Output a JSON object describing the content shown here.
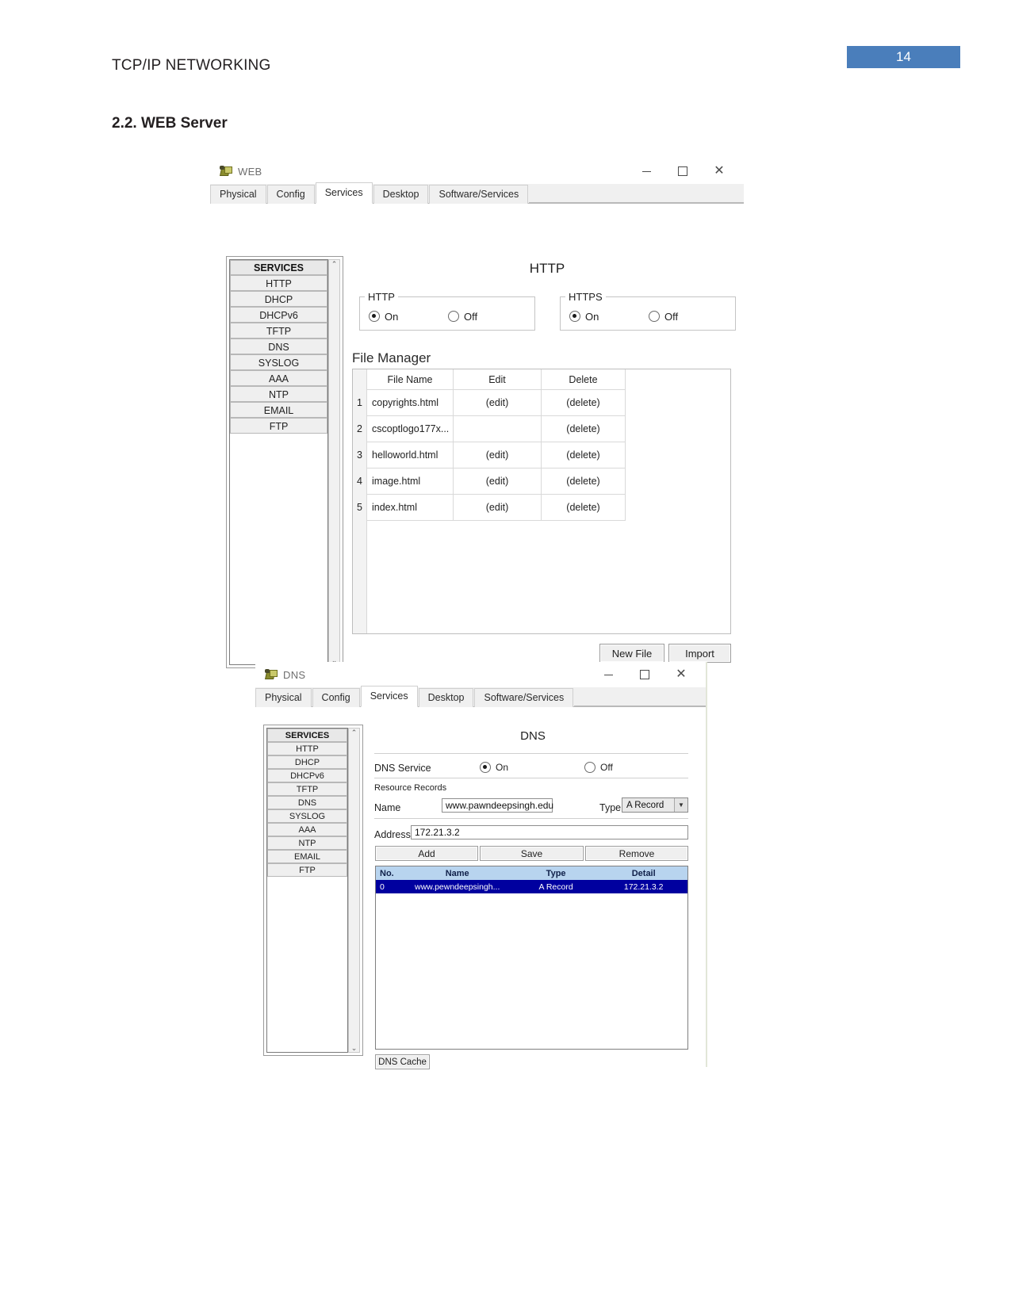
{
  "document": {
    "running_header": "TCP/IP NETWORKING",
    "page_number": "14",
    "section_heading": "2.2. WEB Server",
    "accent_color": "#4a7ebb"
  },
  "web_window": {
    "title": "WEB",
    "window_controls": {
      "minimize": "–",
      "maximize": "□",
      "close": "✕"
    },
    "tabs": [
      {
        "label": "Physical",
        "active": false
      },
      {
        "label": "Config",
        "active": false
      },
      {
        "label": "Services",
        "active": true
      },
      {
        "label": "Desktop",
        "active": false
      },
      {
        "label": "Software/Services",
        "active": false
      }
    ],
    "services_sidebar": {
      "header": "SERVICES",
      "items": [
        "HTTP",
        "DHCP",
        "DHCPv6",
        "TFTP",
        "DNS",
        "SYSLOG",
        "AAA",
        "NTP",
        "EMAIL",
        "FTP"
      ],
      "scroll_up": "⌃",
      "scroll_down": "⌄"
    },
    "panel_title": "HTTP",
    "http_group": {
      "legend": "HTTP",
      "on_label": "On",
      "off_label": "Off",
      "selected": "On"
    },
    "https_group": {
      "legend": "HTTPS",
      "on_label": "On",
      "off_label": "Off",
      "selected": "On"
    },
    "file_manager": {
      "title": "File Manager",
      "columns": [
        "File Name",
        "Edit",
        "Delete"
      ],
      "rows": [
        {
          "no": "1",
          "file_name": "copyrights.html",
          "edit": "(edit)",
          "delete": "(delete)"
        },
        {
          "no": "2",
          "file_name": "cscoptlogo177x...",
          "edit": "",
          "delete": "(delete)"
        },
        {
          "no": "3",
          "file_name": "helloworld.html",
          "edit": "(edit)",
          "delete": "(delete)"
        },
        {
          "no": "4",
          "file_name": "image.html",
          "edit": "(edit)",
          "delete": "(delete)"
        },
        {
          "no": "5",
          "file_name": "index.html",
          "edit": "(edit)",
          "delete": "(delete)"
        }
      ],
      "new_file_button": "New File",
      "import_button": "Import"
    }
  },
  "dns_window": {
    "title": "DNS",
    "window_controls": {
      "minimize": "–",
      "maximize": "□",
      "close": "✕"
    },
    "tabs": [
      {
        "label": "Physical",
        "active": false
      },
      {
        "label": "Config",
        "active": false
      },
      {
        "label": "Services",
        "active": true
      },
      {
        "label": "Desktop",
        "active": false
      },
      {
        "label": "Software/Services",
        "active": false
      }
    ],
    "services_sidebar": {
      "header": "SERVICES",
      "items": [
        "HTTP",
        "DHCP",
        "DHCPv6",
        "TFTP",
        "DNS",
        "SYSLOG",
        "AAA",
        "NTP",
        "EMAIL",
        "FTP"
      ],
      "scroll_up": "⌃",
      "scroll_down": "⌄"
    },
    "panel_title": "DNS",
    "dns_service": {
      "label": "DNS Service",
      "on_label": "On",
      "off_label": "Off",
      "selected": "On"
    },
    "resource_records": {
      "section_label": "Resource Records",
      "name_label": "Name",
      "name_value": "www.pawndeepsingh.edu",
      "type_label": "Type",
      "type_value": "A Record",
      "type_arrow": "▼",
      "address_label": "Address",
      "address_value": "172.21.3.2",
      "add_button": "Add",
      "save_button": "Save",
      "remove_button": "Remove",
      "columns": [
        "No.",
        "Name",
        "Type",
        "Detail"
      ],
      "rows": [
        {
          "no": "0",
          "name": "www.pewndeepsingh...",
          "type": "A Record",
          "detail": "172.21.3.2",
          "selected": true
        }
      ]
    },
    "dns_cache_button": "DNS Cache"
  }
}
